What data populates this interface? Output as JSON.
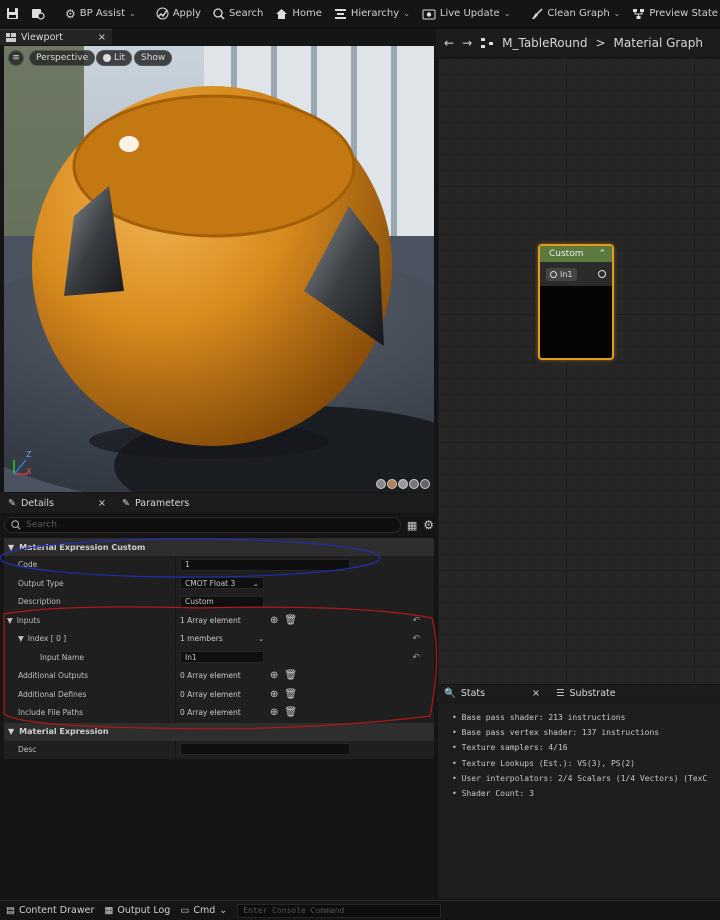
{
  "toolbar": {
    "items": [
      {
        "label": "",
        "icon": "save-icon"
      },
      {
        "label": "",
        "icon": "browse-icon"
      },
      {
        "label": "BP Assist",
        "icon": "gear-icon"
      },
      {
        "label": "Apply",
        "icon": "apply-icon"
      },
      {
        "label": "Search",
        "icon": "search-icon"
      },
      {
        "label": "Home",
        "icon": "home-icon"
      },
      {
        "label": "Hierarchy",
        "icon": "hierarchy-icon"
      },
      {
        "label": "Live Update",
        "icon": "live-update-icon"
      },
      {
        "label": "Clean Graph",
        "icon": "clean-graph-icon"
      },
      {
        "label": "Preview State",
        "icon": "preview-state-icon"
      }
    ]
  },
  "viewport": {
    "tab_label": "Viewport",
    "perspective": "Perspective",
    "lit": "Lit",
    "show": "Show",
    "axis_z": "Z",
    "axis_x": "X"
  },
  "details": {
    "tab_details": "Details",
    "tab_parameters": "Parameters",
    "search_placeholder": "Search",
    "cat_custom": "Material Expression Custom",
    "code_label": "Code",
    "code_value": "1",
    "output_type_label": "Output Type",
    "output_type_value": "CMOT Float 3",
    "description_label": "Description",
    "description_value": "Custom",
    "inputs_label": "Inputs",
    "inputs_value": "1 Array element",
    "index_label": "Index [ 0 ]",
    "index_value": "1 members",
    "input_name_label": "Input Name",
    "input_name_value": "In1",
    "add_outputs_label": "Additional Outputs",
    "add_outputs_value": "0 Array element",
    "add_defines_label": "Additional Defines",
    "add_defines_value": "0 Array element",
    "include_paths_label": "Include File Paths",
    "include_paths_value": "0 Array element",
    "cat_expr": "Material Expression",
    "desc_label": "Desc",
    "desc_value": ""
  },
  "graph": {
    "asset": "M_TableRound",
    "breadcrumb_sep": ">",
    "title": "Material Graph",
    "node_title": "Custom",
    "node_input": "In1"
  },
  "stats": {
    "tab_stats": "Stats",
    "tab_substrate": "Substrate",
    "lines": [
      "Base pass shader: 213 instructions",
      "Base pass vertex shader: 137 instructions",
      "Texture samplers: 4/16",
      "Texture Lookups (Est.): VS(3), PS(2)",
      "User interpolators: 2/4 Scalars (1/4 Vectors) (TexC",
      "Shader Count: 3"
    ]
  },
  "bottom": {
    "content_drawer": "Content Drawer",
    "output_log": "Output Log",
    "cmd": "Cmd",
    "console_placeholder": "Enter Console Command"
  },
  "colors": {
    "node_border": "#e79b18",
    "node_header": "#5c7a3e",
    "annotation_blue": "#1f2fb0",
    "annotation_red": "#b01818"
  }
}
